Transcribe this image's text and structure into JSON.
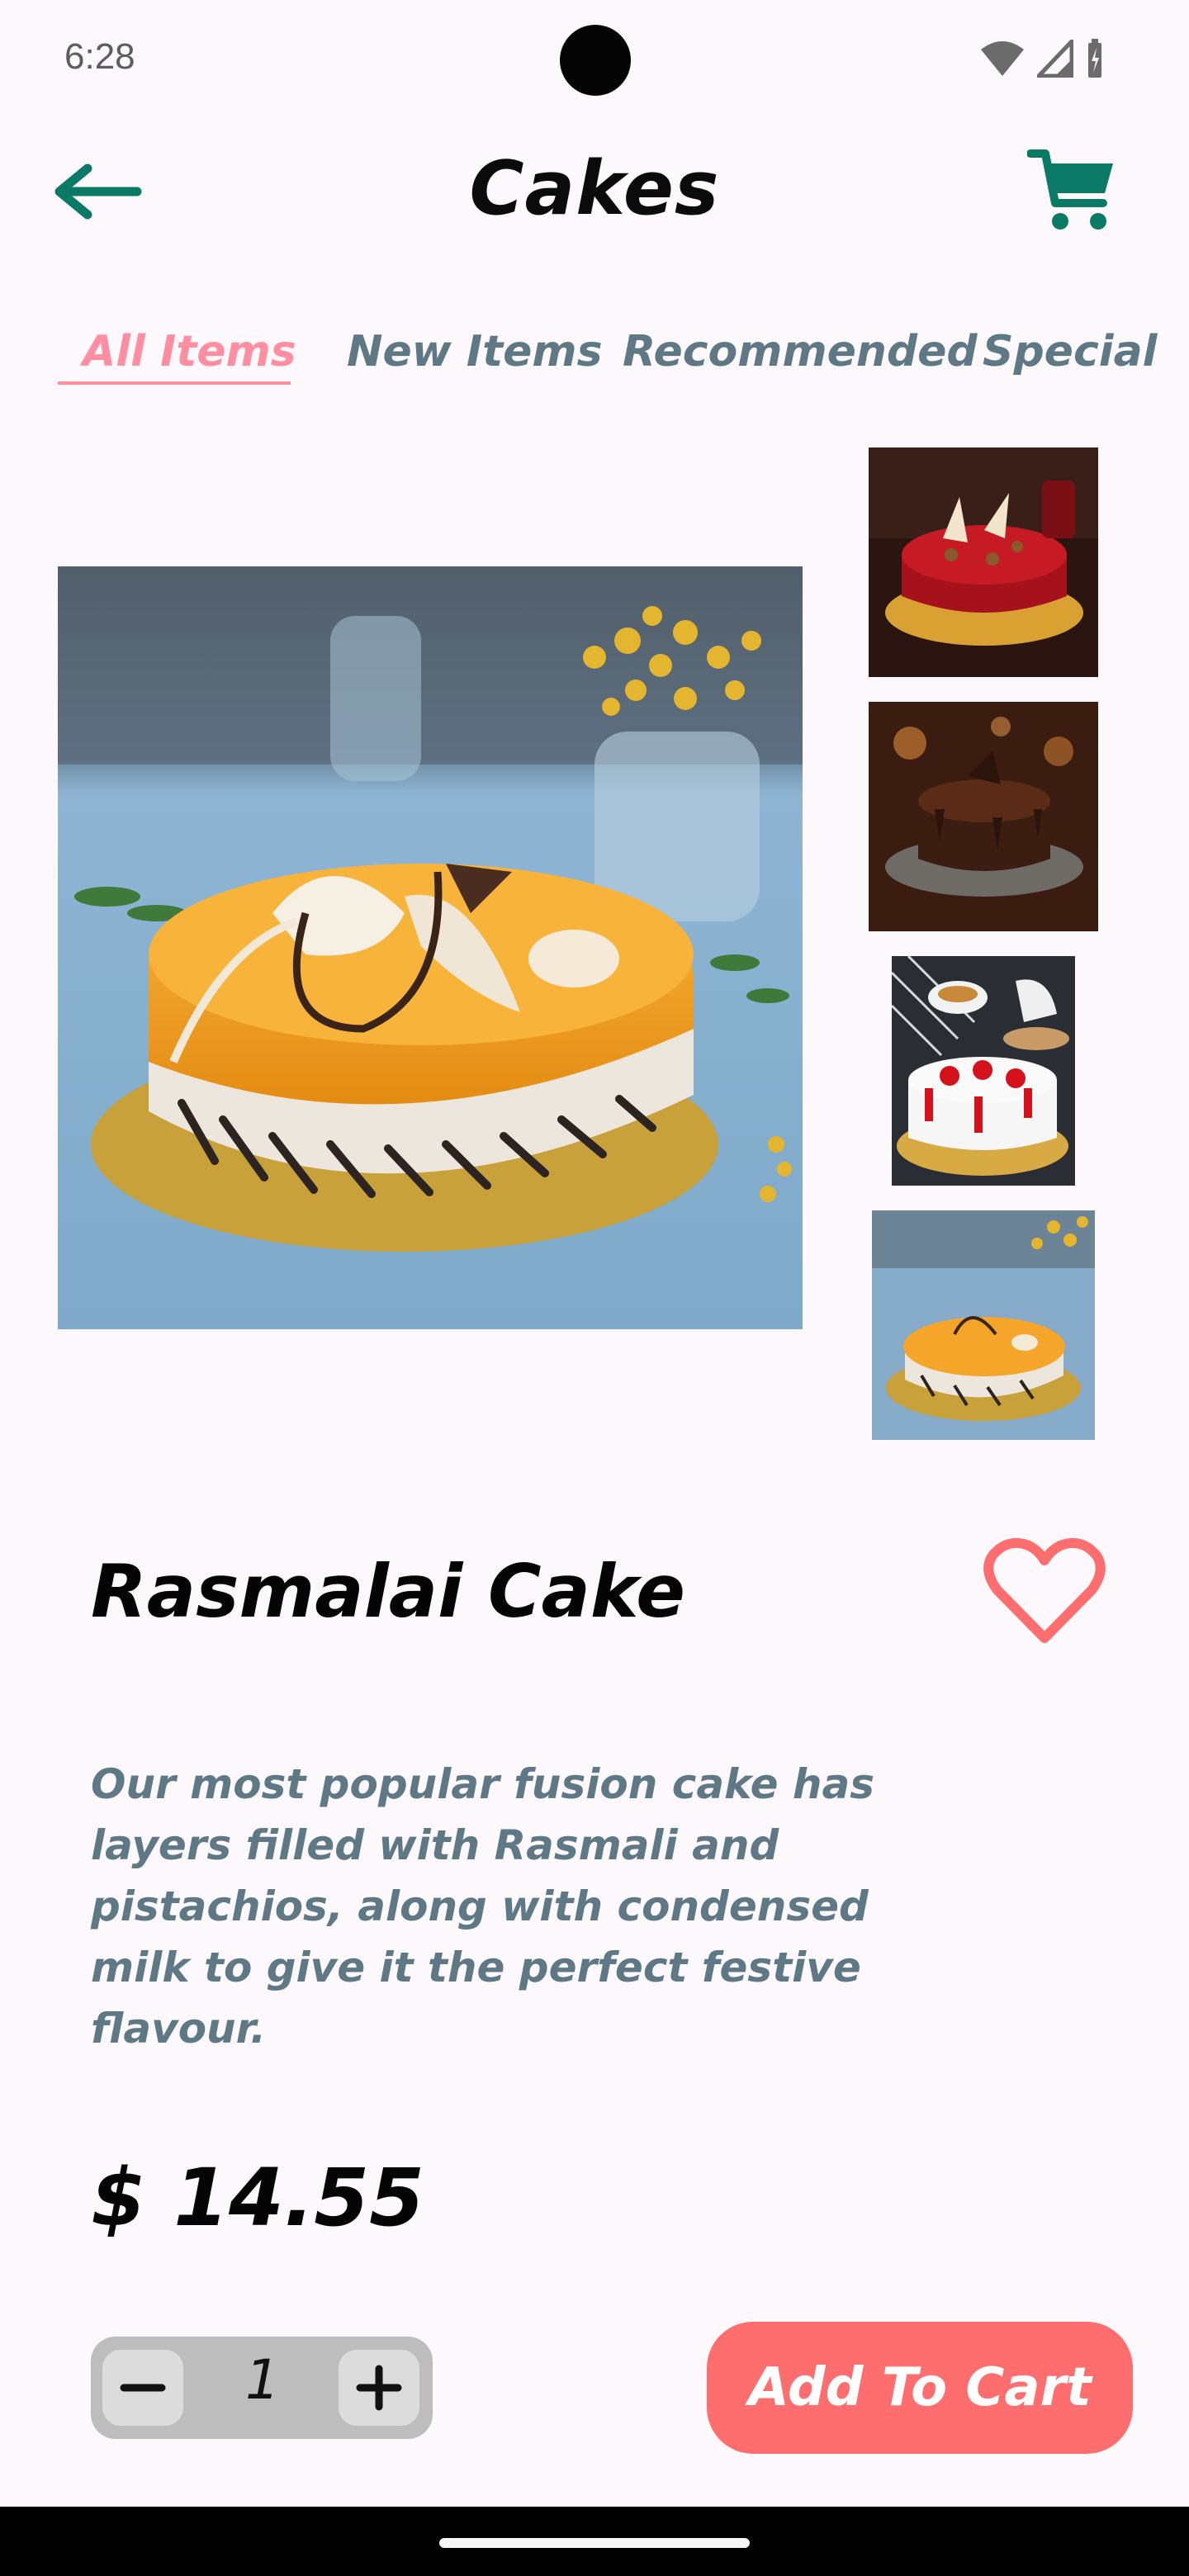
{
  "status_bar": {
    "time": "6:28"
  },
  "app_bar": {
    "title": "Cakes"
  },
  "tabs": [
    {
      "label": "All Items",
      "active": true
    },
    {
      "label": "New Items",
      "active": false
    },
    {
      "label": "Recommended",
      "active": false
    },
    {
      "label": "Special",
      "active": false
    }
  ],
  "product": {
    "name": "Rasmalai Cake",
    "description": "Our most popular fusion cake has layers filled with Rasmali and pistachios, along with condensed milk to give it the perfect festive flavour.",
    "price": "$ 14.55",
    "quantity": "1"
  },
  "actions": {
    "add_to_cart": "Add To Cart"
  },
  "colors": {
    "accent_pink": "#ff8fa0",
    "button_red": "#ff6e6e",
    "icon_teal": "#0a7a66",
    "muted_text": "#5f7886"
  },
  "icons": {
    "back": "arrow-left-icon",
    "cart": "shopping-cart-icon",
    "favorite": "heart-outline-icon",
    "minus": "minus-icon",
    "plus": "plus-icon"
  }
}
